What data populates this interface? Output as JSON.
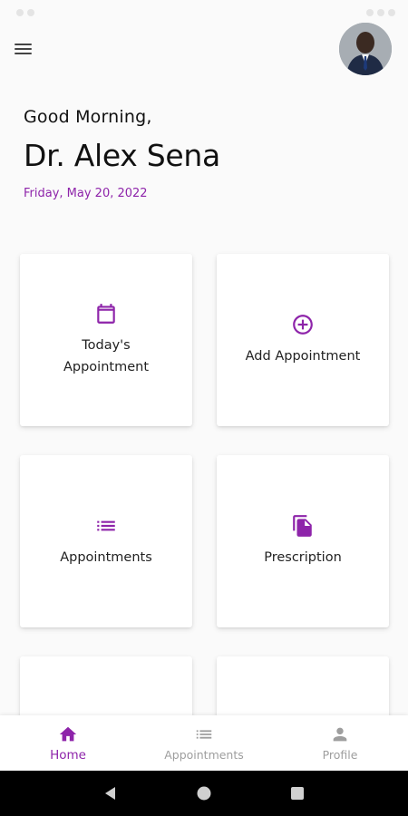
{
  "header": {
    "greeting": "Good Morning,",
    "doctor_name": "Dr. Alex Sena",
    "date": "Friday, May 20, 2022"
  },
  "cards": [
    {
      "label": "Today's Appointment",
      "icon": "calendar-icon"
    },
    {
      "label": "Add Appointment",
      "icon": "add-circle-icon"
    },
    {
      "label": "Appointments",
      "icon": "list-icon"
    },
    {
      "label": "Prescription",
      "icon": "file-copy-icon"
    }
  ],
  "bottom_nav": {
    "items": [
      {
        "label": "Home",
        "icon": "home-icon",
        "active": true
      },
      {
        "label": "Appointments",
        "icon": "list-icon",
        "active": false
      },
      {
        "label": "Profile",
        "icon": "person-icon",
        "active": false
      }
    ]
  },
  "colors": {
    "accent": "#8e24aa",
    "background": "#fafafa",
    "card": "#ffffff",
    "inactive": "#9e9e9e"
  }
}
